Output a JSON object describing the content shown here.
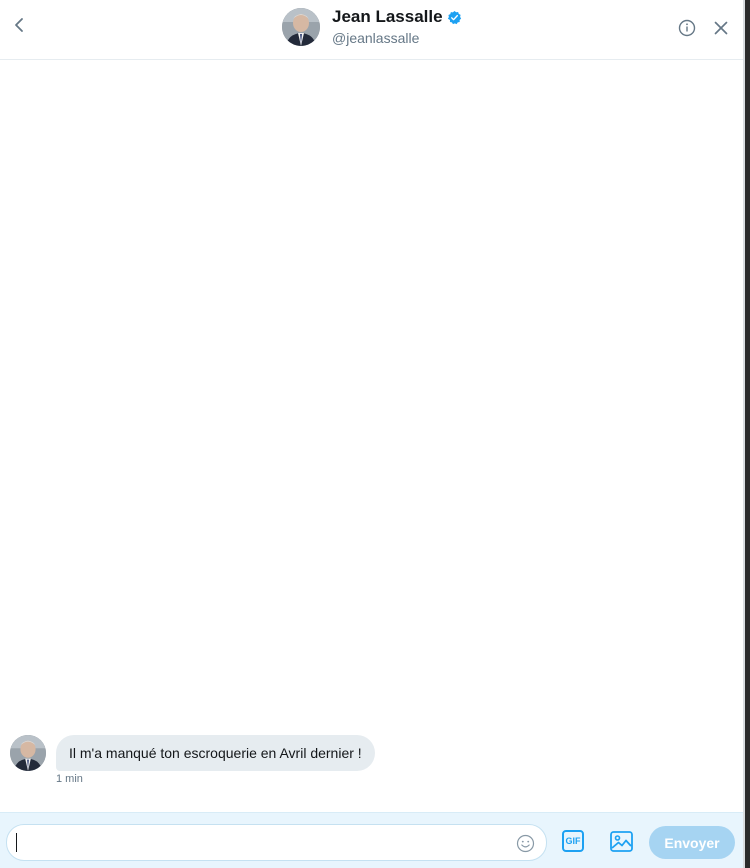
{
  "header": {
    "back_icon": "chevron-left-icon",
    "name": "Jean Lassalle",
    "verified_icon": "verified-badge-icon",
    "handle": "@jeanlassalle",
    "info_icon": "info-icon",
    "close_icon": "close-icon"
  },
  "messages": [
    {
      "sender": "Jean Lassalle",
      "text": "Il m'a manqué ton escroquerie en Avril dernier !",
      "time": "1 min"
    }
  ],
  "composer": {
    "input_value": "",
    "emoji_icon": "emoji-icon",
    "gif_label": "GIF",
    "image_icon": "image-icon",
    "send_label": "Envoyer"
  },
  "colors": {
    "accent": "#1da1f2",
    "send_disabled": "#a6d4f2",
    "bubble": "#e6ecf0",
    "composer_bg": "#e8f5fd"
  }
}
